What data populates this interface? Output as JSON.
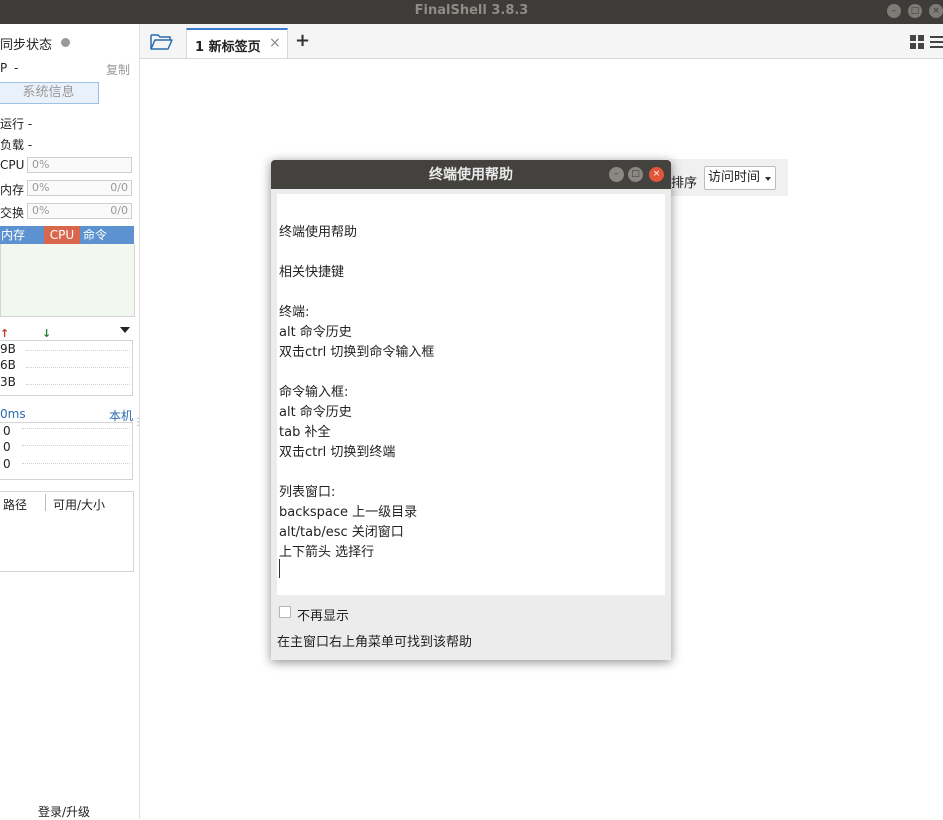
{
  "window": {
    "title": "FinalShell 3.8.3"
  },
  "sidebar": {
    "sync_status": "同步状态",
    "ip_label": "P",
    "ip_value": "-",
    "copy_label": "复制",
    "sysinfo_button": "系统信息",
    "uptime": "运行 -",
    "load": "负载 -",
    "cpu_label": "CPU",
    "cpu_value": "0%",
    "mem_label": "内存",
    "mem_value": "0%",
    "mem_ratio": "0/0",
    "swap_label": "交换",
    "swap_value": "0%",
    "swap_ratio": "0/0",
    "proc_columns": [
      "内存",
      "CPU",
      "命令"
    ],
    "net_rates": [
      "9B",
      "6B",
      "3B"
    ],
    "latency_label": "0ms",
    "latency_host": "本机",
    "latency_values": [
      "0",
      "0",
      "0"
    ],
    "disk_columns": [
      "路径",
      "可用/大小"
    ],
    "login_upgrade": "登录/升级"
  },
  "tabs": {
    "active_tab": "1 新标签页",
    "close_glyph": "×",
    "add_glyph": "+"
  },
  "background": {
    "sort_label": "排序",
    "sort_value": "访问时间"
  },
  "dialog": {
    "title": "终端使用帮助",
    "lines": [
      "终端使用帮助",
      "相关快捷键",
      "终端:",
      "alt 命令历史",
      "双击ctrl 切换到命令输入框",
      "命令输入框:",
      "alt 命令历史",
      "tab 补全",
      "双击ctrl 切换到终端",
      "列表窗口:",
      "backspace 上一级目录",
      "alt/tab/esc 关闭窗口",
      "上下箭头 选择行"
    ],
    "dont_show_again": "不再显示",
    "footer_hint": "在主窗口右上角菜单可找到该帮助"
  },
  "colors": {
    "accent": "#3a7fd5",
    "proc_header": "#5b92cf",
    "cpu_header": "#d9674e",
    "titlebar": "#3d3c38",
    "close_button": "#e2573a"
  }
}
